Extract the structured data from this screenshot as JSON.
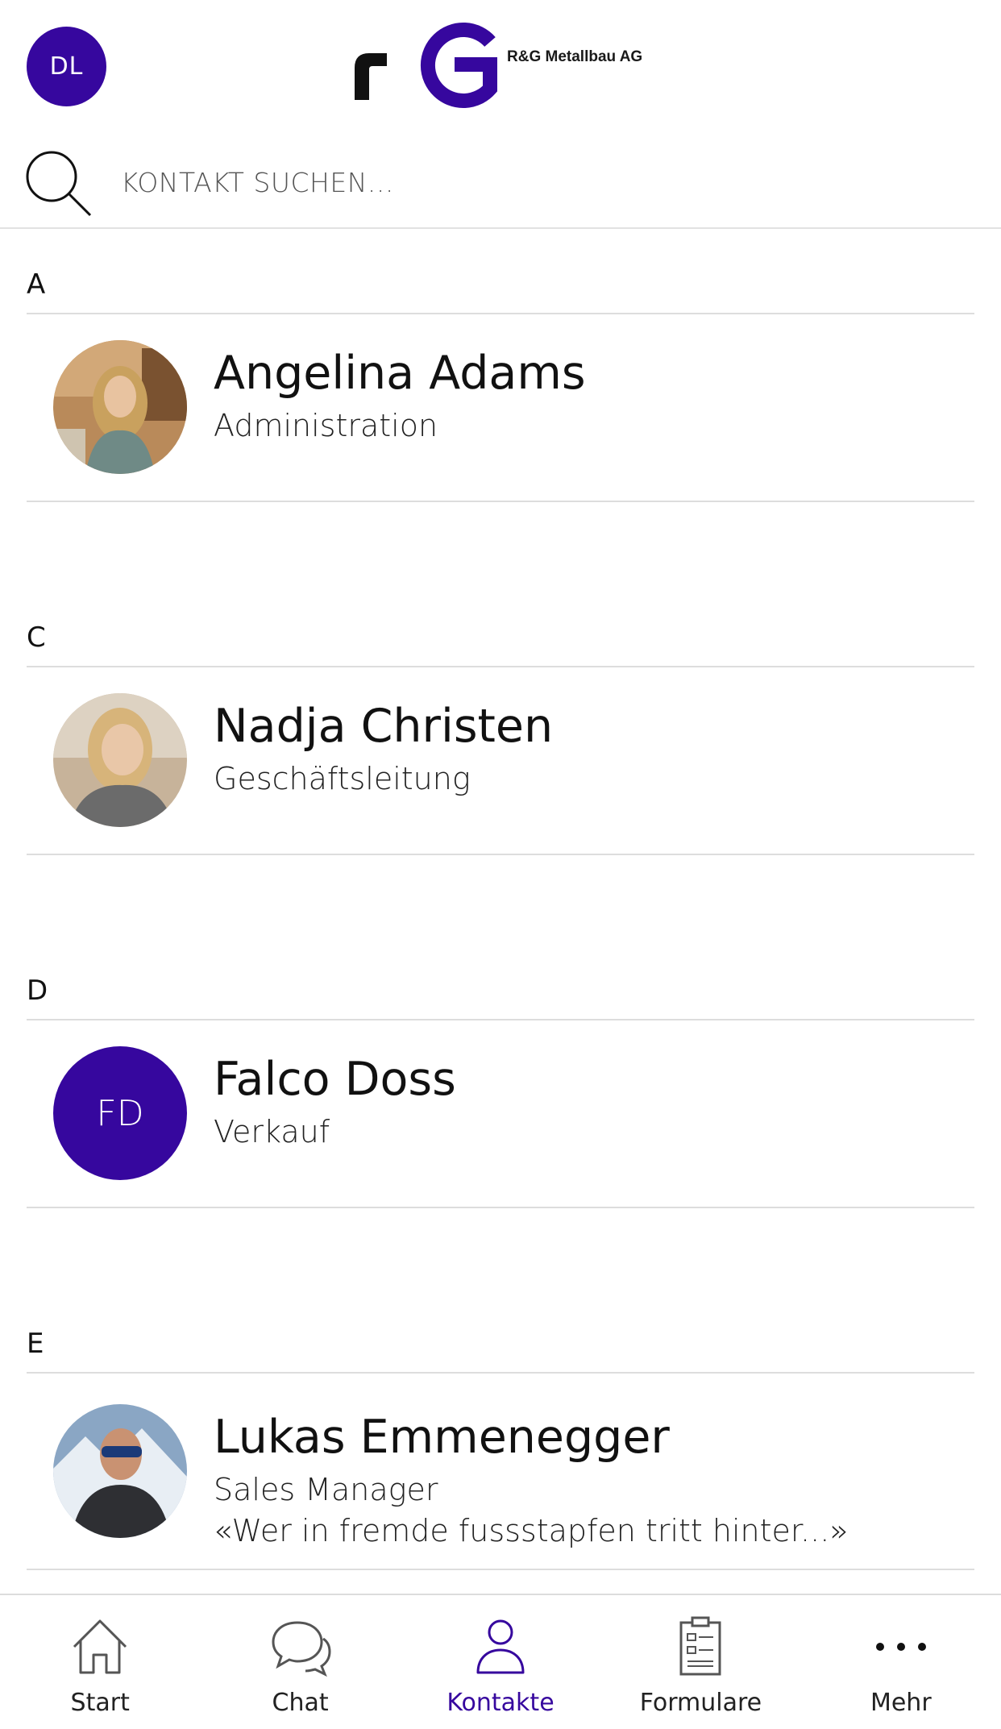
{
  "header": {
    "user_initials": "DL",
    "company_name": "R&G Metallbau AG",
    "accent_color": "#36079e"
  },
  "search": {
    "placeholder": "KONTAKT SUCHEN...",
    "value": ""
  },
  "contacts": {
    "sections": [
      {
        "letter": "A",
        "items": [
          {
            "name": "Angelina Adams",
            "role": "Administration"
          }
        ]
      },
      {
        "letter": "C",
        "items": [
          {
            "name": "Nadja Christen",
            "role": "Geschäftsleitung"
          }
        ]
      },
      {
        "letter": "D",
        "items": [
          {
            "name": "Falco Doss",
            "role": "Verkauf",
            "initials": "FD"
          }
        ]
      },
      {
        "letter": "E",
        "items": [
          {
            "name": "Lukas Emmenegger",
            "role": "Sales Manager",
            "quote": "«Wer in fremde fussstapfen tritt hinter...»"
          }
        ]
      }
    ]
  },
  "bottom_nav": {
    "items": [
      {
        "label": "Start",
        "icon": "home-icon"
      },
      {
        "label": "Chat",
        "icon": "chat-icon"
      },
      {
        "label": "Kontakte",
        "icon": "contacts-icon",
        "active": true
      },
      {
        "label": "Formulare",
        "icon": "forms-icon"
      },
      {
        "label": "Mehr",
        "icon": "more-icon"
      }
    ]
  }
}
